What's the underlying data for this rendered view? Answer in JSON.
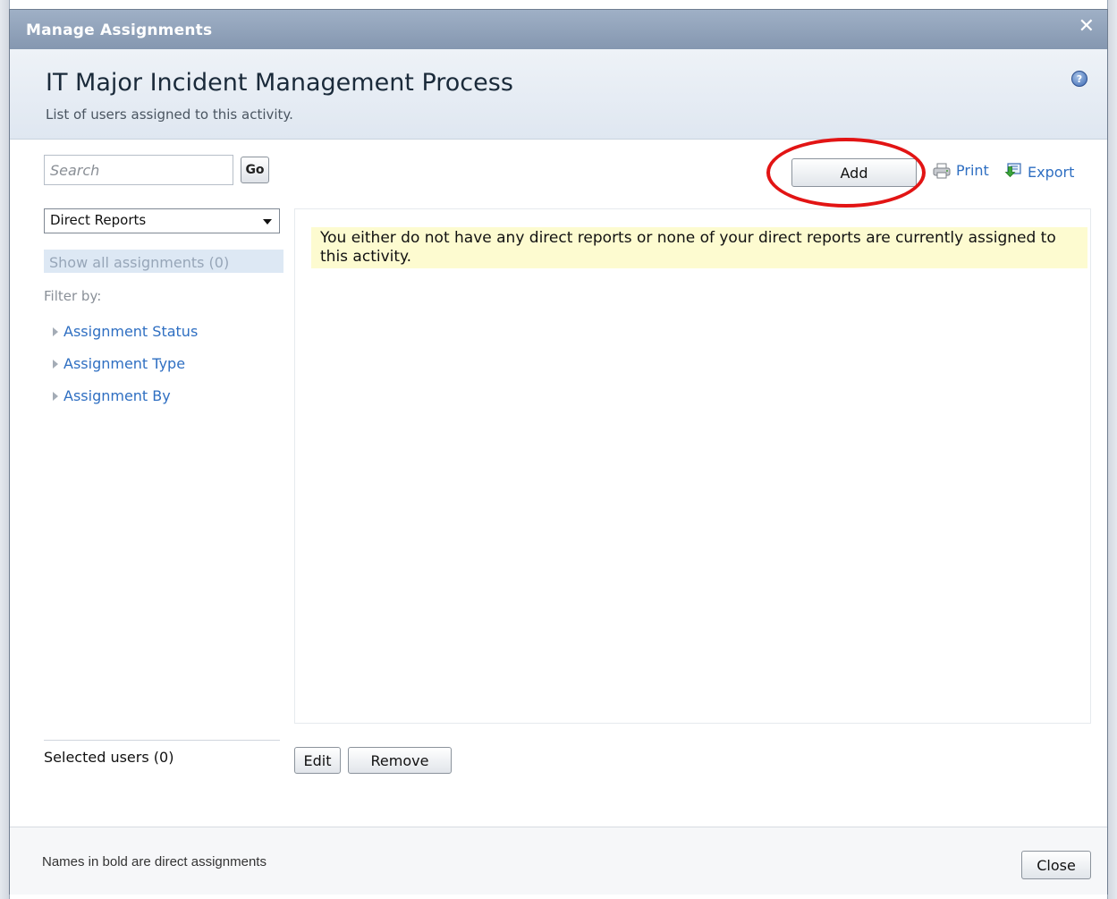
{
  "window": {
    "title": "Manage Assignments"
  },
  "header": {
    "title": "IT Major Incident Management Process",
    "subtitle": "List of users assigned to this activity."
  },
  "icons": {
    "close": "close-icon",
    "help": "help-icon",
    "print": "printer-icon",
    "export": "export-icon",
    "expand": "triangle-right-icon"
  },
  "search": {
    "placeholder": "Search",
    "value": "",
    "go_label": "Go"
  },
  "filter_select": {
    "selected": "Direct Reports"
  },
  "sidebar": {
    "show_all": "Show all assignments (0)",
    "filter_by_label": "Filter by:",
    "filters": [
      {
        "label": "Assignment Status"
      },
      {
        "label": "Assignment Type"
      },
      {
        "label": "Assignment By"
      }
    ],
    "selected_users": "Selected users (0)"
  },
  "toolbar": {
    "add_label": "Add",
    "print_label": "Print",
    "export_label": "Export"
  },
  "content": {
    "notice": "You either do not have any direct reports or none of your direct reports are currently assigned to this activity."
  },
  "actions": {
    "edit_label": "Edit",
    "remove_label": "Remove"
  },
  "footer": {
    "note": "Names in bold are direct assignments",
    "close_label": "Close"
  },
  "colors": {
    "link": "#2f6fc2",
    "titlebar": "#8fa1b9",
    "notice_bg": "#fdfbd0",
    "highlight_circle": "#e21414"
  }
}
